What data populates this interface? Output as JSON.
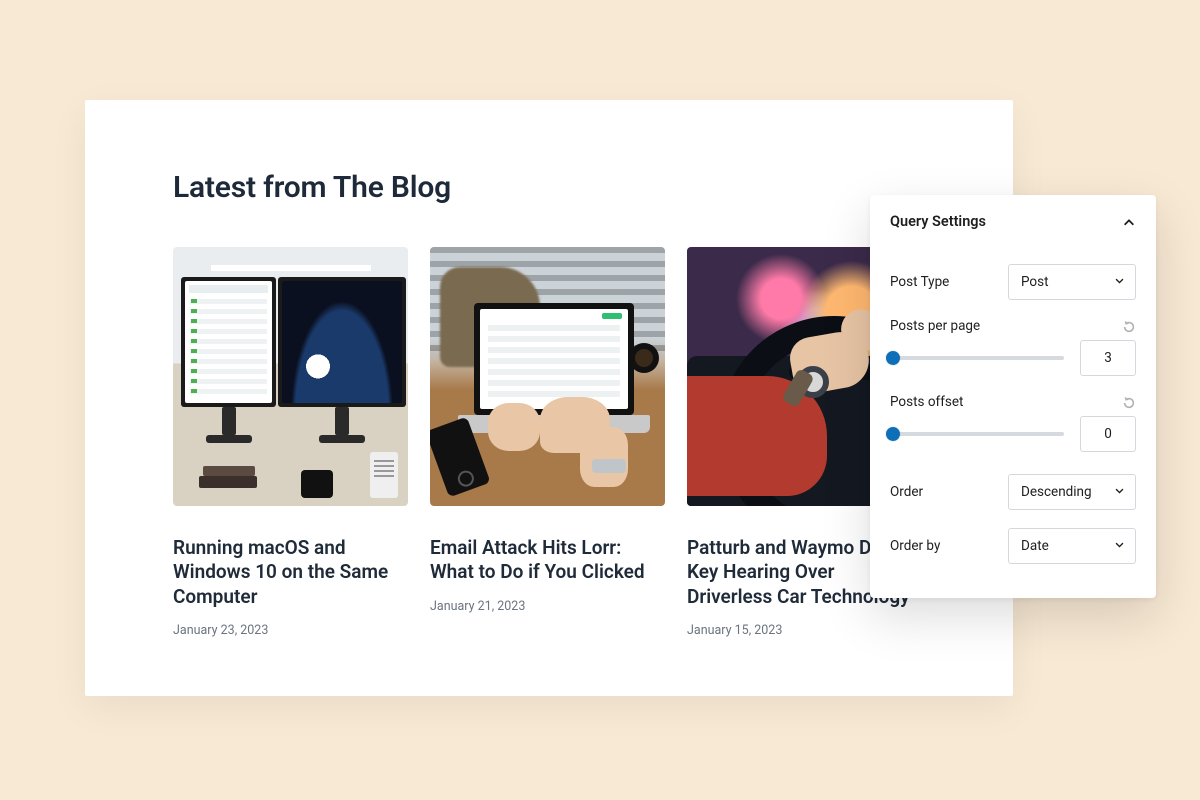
{
  "section": {
    "title": "Latest from The Blog"
  },
  "posts": [
    {
      "title": "Running macOS and Windows 10 on the Same Computer",
      "date": "January 23, 2023"
    },
    {
      "title": "Email Attack Hits Lorr: What to Do if You Clicked",
      "date": "January 21, 2023"
    },
    {
      "title": "Patturb and Waymo Delay Key Hearing Over Driverless Car Technology",
      "date": "January 15, 2023"
    }
  ],
  "panel": {
    "title": "Query Settings",
    "post_type": {
      "label": "Post Type",
      "value": "Post"
    },
    "per_page": {
      "label": "Posts per page",
      "value": "3"
    },
    "offset": {
      "label": "Posts offset",
      "value": "0"
    },
    "order": {
      "label": "Order",
      "value": "Descending"
    },
    "order_by": {
      "label": "Order by",
      "value": "Date"
    }
  }
}
